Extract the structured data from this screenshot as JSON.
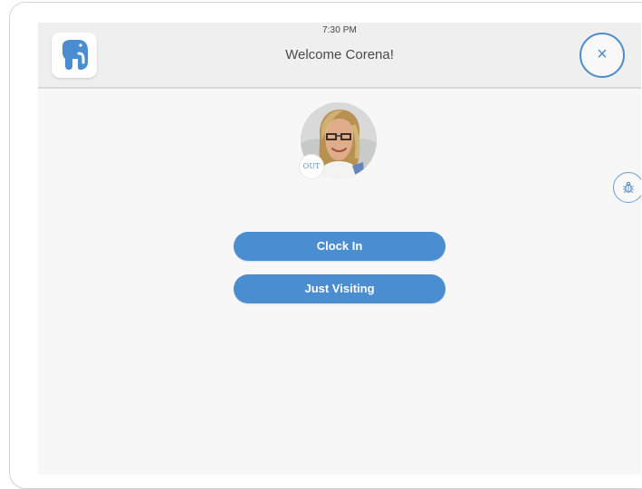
{
  "header": {
    "time": "7:30 PM",
    "welcome": "Welcome Corena!",
    "close_icon": "×",
    "logo_icon": "elephant-logo-icon"
  },
  "profile": {
    "status": "OUT",
    "avatar": "profile-photo"
  },
  "actions": {
    "clock_in": "Clock In",
    "just_visiting": "Just Visiting"
  },
  "side_tools": {
    "bug_icon": "bug-icon"
  },
  "colors": {
    "accent_blue": "#4a8dd0",
    "screen_background": "#f7f7f7",
    "header_background": "#efefef",
    "button_text": "#ffffff"
  }
}
